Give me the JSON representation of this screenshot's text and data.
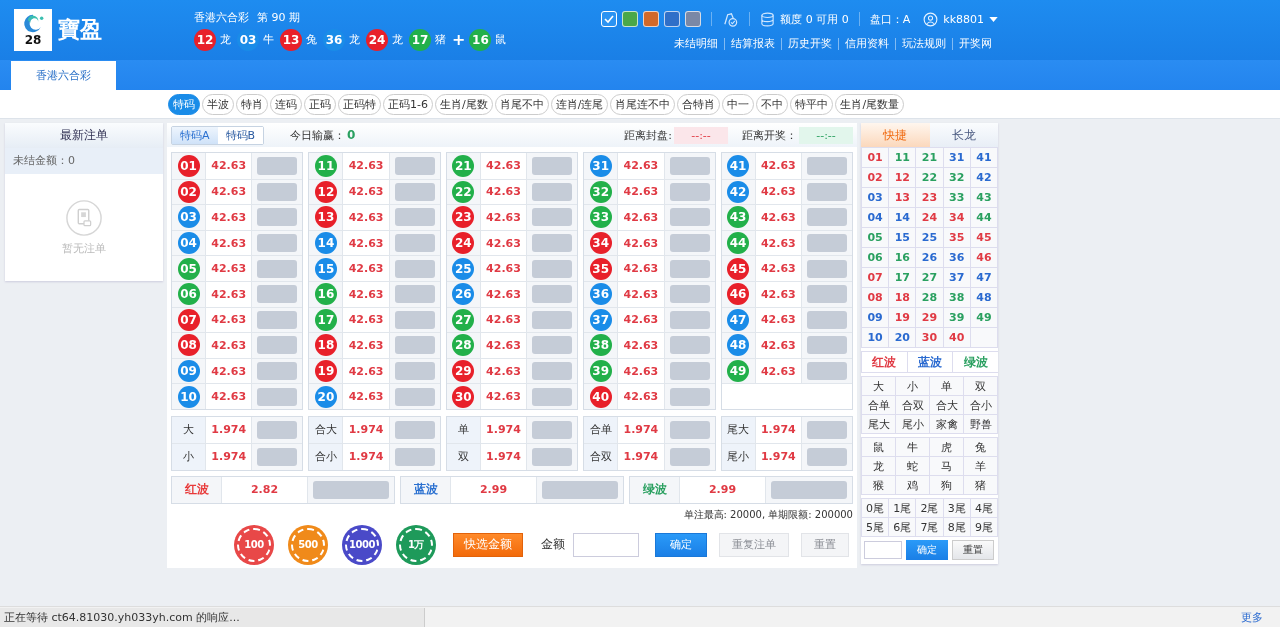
{
  "logo": {
    "badge": "28",
    "name": "寶盈"
  },
  "draw": {
    "title": "香港六合彩",
    "period": "第 90 期",
    "plus": "+",
    "results": [
      {
        "number": "12",
        "zodiac": "龙",
        "color": "#e8202a"
      },
      {
        "number": "03",
        "zodiac": "牛",
        "color": "#1a8ce8"
      },
      {
        "number": "13",
        "zodiac": "兔",
        "color": "#e8202a"
      },
      {
        "number": "36",
        "zodiac": "龙",
        "color": "#1a8ce8"
      },
      {
        "number": "24",
        "zodiac": "龙",
        "color": "#e8202a"
      },
      {
        "number": "17",
        "zodiac": "猪",
        "color": "#22b04a"
      }
    ],
    "special": {
      "number": "16",
      "zodiac": "鼠",
      "color": "#22b04a"
    }
  },
  "theme_swatches": [
    {
      "color": "#2b93f2",
      "selected": true
    },
    {
      "color": "#4aa84a",
      "selected": false
    },
    {
      "color": "#d2692a",
      "selected": false
    },
    {
      "color": "#2f6fc8",
      "selected": false
    },
    {
      "color": "#7a88a6",
      "selected": false
    }
  ],
  "account": {
    "credit": "额度 0 可用 0",
    "market": "盘口：A",
    "user": "kk8801"
  },
  "links": [
    "未结明细",
    "结算报表",
    "历史开奖",
    "信用资料",
    "玩法规则",
    "开奖网"
  ],
  "lottery_tabs": [
    {
      "label": "香港六合彩",
      "selected": true
    }
  ],
  "play_tabs": [
    {
      "label": "特码",
      "selected": true
    },
    {
      "label": "半波",
      "selected": false
    },
    {
      "label": "特肖",
      "selected": false
    },
    {
      "label": "连码",
      "selected": false
    },
    {
      "label": "正码",
      "selected": false
    },
    {
      "label": "正码特",
      "selected": false
    },
    {
      "label": "正码1-6",
      "selected": false
    },
    {
      "label": "生肖/尾数",
      "selected": false
    },
    {
      "label": "肖尾不中",
      "selected": false
    },
    {
      "label": "连肖/连尾",
      "selected": false
    },
    {
      "label": "肖尾连不中",
      "selected": false
    },
    {
      "label": "合特肖",
      "selected": false
    },
    {
      "label": "中一",
      "selected": false
    },
    {
      "label": "不中",
      "selected": false
    },
    {
      "label": "特平中",
      "selected": false
    },
    {
      "label": "生肖/尾数量",
      "selected": false
    }
  ],
  "recent_bets": {
    "title": "最新注单",
    "unsettled": "未结金额：0",
    "empty": "暂无注单"
  },
  "sub_tabs": [
    {
      "label": "特码A",
      "selected": true
    },
    {
      "label": "特码B",
      "selected": false
    }
  ],
  "today": {
    "label": "今日输赢：",
    "value": "0"
  },
  "close_timer": {
    "label": "距离封盘:",
    "value": "--:--"
  },
  "draw_timer": {
    "label": "距离开奖：",
    "value": "--:--"
  },
  "balls": [
    {
      "number": "01",
      "odds": "42.63",
      "color": "#e8202a"
    },
    {
      "number": "02",
      "odds": "42.63",
      "color": "#e8202a"
    },
    {
      "number": "03",
      "odds": "42.63",
      "color": "#1a8ce8"
    },
    {
      "number": "04",
      "odds": "42.63",
      "color": "#1a8ce8"
    },
    {
      "number": "05",
      "odds": "42.63",
      "color": "#22b04a"
    },
    {
      "number": "06",
      "odds": "42.63",
      "color": "#22b04a"
    },
    {
      "number": "07",
      "odds": "42.63",
      "color": "#e8202a"
    },
    {
      "number": "08",
      "odds": "42.63",
      "color": "#e8202a"
    },
    {
      "number": "09",
      "odds": "42.63",
      "color": "#1a8ce8"
    },
    {
      "number": "10",
      "odds": "42.63",
      "color": "#1a8ce8"
    },
    {
      "number": "11",
      "odds": "42.63",
      "color": "#22b04a"
    },
    {
      "number": "12",
      "odds": "42.63",
      "color": "#e8202a"
    },
    {
      "number": "13",
      "odds": "42.63",
      "color": "#e8202a"
    },
    {
      "number": "14",
      "odds": "42.63",
      "color": "#1a8ce8"
    },
    {
      "number": "15",
      "odds": "42.63",
      "color": "#1a8ce8"
    },
    {
      "number": "16",
      "odds": "42.63",
      "color": "#22b04a"
    },
    {
      "number": "17",
      "odds": "42.63",
      "color": "#22b04a"
    },
    {
      "number": "18",
      "odds": "42.63",
      "color": "#e8202a"
    },
    {
      "number": "19",
      "odds": "42.63",
      "color": "#e8202a"
    },
    {
      "number": "20",
      "odds": "42.63",
      "color": "#1a8ce8"
    },
    {
      "number": "21",
      "odds": "42.63",
      "color": "#22b04a"
    },
    {
      "number": "22",
      "odds": "42.63",
      "color": "#22b04a"
    },
    {
      "number": "23",
      "odds": "42.63",
      "color": "#e8202a"
    },
    {
      "number": "24",
      "odds": "42.63",
      "color": "#e8202a"
    },
    {
      "number": "25",
      "odds": "42.63",
      "color": "#1a8ce8"
    },
    {
      "number": "26",
      "odds": "42.63",
      "color": "#1a8ce8"
    },
    {
      "number": "27",
      "odds": "42.63",
      "color": "#22b04a"
    },
    {
      "number": "28",
      "odds": "42.63",
      "color": "#22b04a"
    },
    {
      "number": "29",
      "odds": "42.63",
      "color": "#e8202a"
    },
    {
      "number": "30",
      "odds": "42.63",
      "color": "#e8202a"
    },
    {
      "number": "31",
      "odds": "42.63",
      "color": "#1a8ce8"
    },
    {
      "number": "32",
      "odds": "42.63",
      "color": "#22b04a"
    },
    {
      "number": "33",
      "odds": "42.63",
      "color": "#22b04a"
    },
    {
      "number": "34",
      "odds": "42.63",
      "color": "#e8202a"
    },
    {
      "number": "35",
      "odds": "42.63",
      "color": "#e8202a"
    },
    {
      "number": "36",
      "odds": "42.63",
      "color": "#1a8ce8"
    },
    {
      "number": "37",
      "odds": "42.63",
      "color": "#1a8ce8"
    },
    {
      "number": "38",
      "odds": "42.63",
      "color": "#22b04a"
    },
    {
      "number": "39",
      "odds": "42.63",
      "color": "#22b04a"
    },
    {
      "number": "40",
      "odds": "42.63",
      "color": "#e8202a"
    },
    {
      "number": "41",
      "odds": "42.63",
      "color": "#1a8ce8"
    },
    {
      "number": "42",
      "odds": "42.63",
      "color": "#1a8ce8"
    },
    {
      "number": "43",
      "odds": "42.63",
      "color": "#22b04a"
    },
    {
      "number": "44",
      "odds": "42.63",
      "color": "#22b04a"
    },
    {
      "number": "45",
      "odds": "42.63",
      "color": "#e8202a"
    },
    {
      "number": "46",
      "odds": "42.63",
      "color": "#e8202a"
    },
    {
      "number": "47",
      "odds": "42.63",
      "color": "#1a8ce8"
    },
    {
      "number": "48",
      "odds": "42.63",
      "color": "#1a8ce8"
    },
    {
      "number": "49",
      "odds": "42.63",
      "color": "#22b04a"
    }
  ],
  "two_sided": [
    [
      {
        "label": "大",
        "odds": "1.974"
      },
      {
        "label": "小",
        "odds": "1.974"
      }
    ],
    [
      {
        "label": "合大",
        "odds": "1.974"
      },
      {
        "label": "合小",
        "odds": "1.974"
      }
    ],
    [
      {
        "label": "单",
        "odds": "1.974"
      },
      {
        "label": "双",
        "odds": "1.974"
      }
    ],
    [
      {
        "label": "合单",
        "odds": "1.974"
      },
      {
        "label": "合双",
        "odds": "1.974"
      }
    ],
    [
      {
        "label": "尾大",
        "odds": "1.974"
      },
      {
        "label": "尾小",
        "odds": "1.974"
      }
    ]
  ],
  "waves": [
    {
      "label": "红波",
      "odds": "2.82",
      "color": "#e83a3a"
    },
    {
      "label": "蓝波",
      "odds": "2.99",
      "color": "#2a70d0"
    },
    {
      "label": "绿波",
      "odds": "2.99",
      "color": "#2aa060"
    }
  ],
  "limits": "单注最高: 20000, 单期限额: 200000",
  "chips": [
    {
      "label": "100",
      "color": "#e84848"
    },
    {
      "label": "500",
      "color": "#f08a1a"
    },
    {
      "label": "1000",
      "color": "#4a4ac8"
    },
    {
      "label": "1万",
      "color": "#1e9a5a"
    }
  ],
  "quick_amount": "快选金额",
  "amount_label": "金额",
  "confirm": {
    "label": "确定",
    "disabled": false
  },
  "repeat": {
    "label": "重复注单",
    "disabled": true
  },
  "reset": {
    "label": "重置",
    "disabled": true
  },
  "quick_panel": {
    "tabs": [
      {
        "label": "快捷",
        "selected": true
      },
      {
        "label": "长龙",
        "selected": false
      }
    ],
    "numbers": [
      {
        "number": "01",
        "color": "#e03a44"
      },
      {
        "number": "02",
        "color": "#e03a44"
      },
      {
        "number": "03",
        "color": "#2a6ad0"
      },
      {
        "number": "04",
        "color": "#2a6ad0"
      },
      {
        "number": "05",
        "color": "#2aa060"
      },
      {
        "number": "06",
        "color": "#2aa060"
      },
      {
        "number": "07",
        "color": "#e03a44"
      },
      {
        "number": "08",
        "color": "#e03a44"
      },
      {
        "number": "09",
        "color": "#2a6ad0"
      },
      {
        "number": "10",
        "color": "#2a6ad0"
      },
      {
        "number": "11",
        "color": "#2aa060"
      },
      {
        "number": "12",
        "color": "#e03a44"
      },
      {
        "number": "13",
        "color": "#e03a44"
      },
      {
        "number": "14",
        "color": "#2a6ad0"
      },
      {
        "number": "15",
        "color": "#2a6ad0"
      },
      {
        "number": "16",
        "color": "#2aa060"
      },
      {
        "number": "17",
        "color": "#2aa060"
      },
      {
        "number": "18",
        "color": "#e03a44"
      },
      {
        "number": "19",
        "color": "#e03a44"
      },
      {
        "number": "20",
        "color": "#2a6ad0"
      },
      {
        "number": "21",
        "color": "#2aa060"
      },
      {
        "number": "22",
        "color": "#2aa060"
      },
      {
        "number": "23",
        "color": "#e03a44"
      },
      {
        "number": "24",
        "color": "#e03a44"
      },
      {
        "number": "25",
        "color": "#2a6ad0"
      },
      {
        "number": "26",
        "color": "#2a6ad0"
      },
      {
        "number": "27",
        "color": "#2aa060"
      },
      {
        "number": "28",
        "color": "#2aa060"
      },
      {
        "number": "29",
        "color": "#e03a44"
      },
      {
        "number": "30",
        "color": "#e03a44"
      },
      {
        "number": "31",
        "color": "#2a6ad0"
      },
      {
        "number": "32",
        "color": "#2aa060"
      },
      {
        "number": "33",
        "color": "#2aa060"
      },
      {
        "number": "34",
        "color": "#e03a44"
      },
      {
        "number": "35",
        "color": "#e03a44"
      },
      {
        "number": "36",
        "color": "#2a6ad0"
      },
      {
        "number": "37",
        "color": "#2a6ad0"
      },
      {
        "number": "38",
        "color": "#2aa060"
      },
      {
        "number": "39",
        "color": "#2aa060"
      },
      {
        "number": "40",
        "color": "#e03a44"
      },
      {
        "number": "41",
        "color": "#2a6ad0"
      },
      {
        "number": "42",
        "color": "#2a6ad0"
      },
      {
        "number": "43",
        "color": "#2aa060"
      },
      {
        "number": "44",
        "color": "#2aa060"
      },
      {
        "number": "45",
        "color": "#e03a44"
      },
      {
        "number": "46",
        "color": "#e03a44"
      },
      {
        "number": "47",
        "color": "#2a6ad0"
      },
      {
        "number": "48",
        "color": "#2a6ad0"
      },
      {
        "number": "49",
        "color": "#2aa060"
      }
    ],
    "waves": [
      {
        "label": "红波",
        "color": "#e03a44"
      },
      {
        "label": "蓝波",
        "color": "#2a6ad0"
      },
      {
        "label": "绿波",
        "color": "#2aa060"
      }
    ],
    "groups": [
      "大",
      "小",
      "单",
      "双",
      "合单",
      "合双",
      "合大",
      "合小",
      "尾大",
      "尾小",
      "家禽",
      "野兽"
    ],
    "zodiacs": [
      "鼠",
      "牛",
      "虎",
      "兔",
      "龙",
      "蛇",
      "马",
      "羊",
      "猴",
      "鸡",
      "狗",
      "猪"
    ],
    "tails": [
      "0尾",
      "1尾",
      "2尾",
      "3尾",
      "4尾",
      "5尾",
      "6尾",
      "7尾",
      "8尾",
      "9尾"
    ],
    "confirm": "确定",
    "reset": "重置"
  },
  "status": {
    "text": "正在等待 ct64.81030.yh033yh.com 的响应...",
    "more": "更多"
  }
}
